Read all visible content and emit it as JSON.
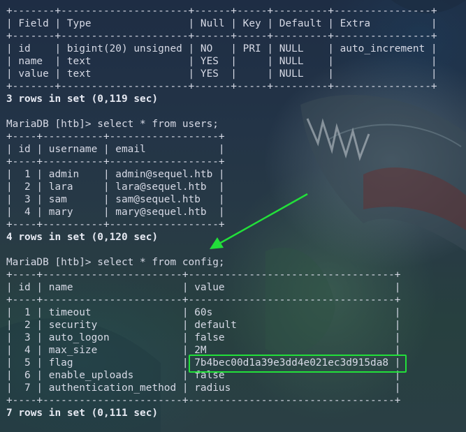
{
  "terminal": {
    "lines": [
      "+-------+---------------------+------+-----+---------+----------------+",
      "| Field | Type                | Null | Key | Default | Extra          |",
      "+-------+---------------------+------+-----+---------+----------------+",
      "| id    | bigint(20) unsigned | NO   | PRI | NULL    | auto_increment |",
      "| name  | text                | YES  |     | NULL    |                |",
      "| value | text                | YES  |     | NULL    |                |",
      "+-------+---------------------+------+-----+---------+----------------+",
      "3 rows in set (0,119 sec)",
      "",
      "MariaDB [htb]> select * from users;",
      "+----+----------+------------------+",
      "| id | username | email            |",
      "+----+----------+------------------+",
      "|  1 | admin    | admin@sequel.htb |",
      "|  2 | lara     | lara@sequel.htb  |",
      "|  3 | sam      | sam@sequel.htb   |",
      "|  4 | mary     | mary@sequel.htb  |",
      "+----+----------+------------------+",
      "4 rows in set (0,120 sec)",
      "",
      "MariaDB [htb]> select * from config;",
      "+----+-----------------------+----------------------------------+",
      "| id | name                  | value                            |",
      "+----+-----------------------+----------------------------------+",
      "|  1 | timeout               | 60s                              |",
      "|  2 | security              | default                          |",
      "|  3 | auto_logon            | false                            |",
      "|  4 | max_size              | 2M                               |",
      "|  5 | flag                  | 7b4bec00d1a39e3dd4e021ec3d915da8 |",
      "|  6 | enable_uploads        | false                            |",
      "|  7 | authentication_method | radius                           |",
      "+----+-----------------------+----------------------------------+",
      "7 rows in set (0,111 sec)"
    ]
  },
  "colors": {
    "annotation": "#22e03a"
  }
}
